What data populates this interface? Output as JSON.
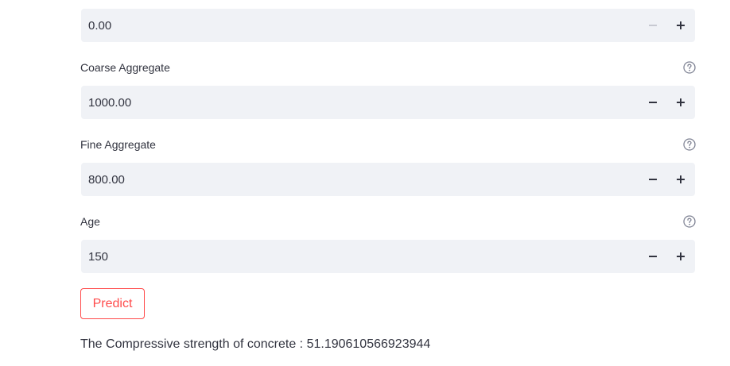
{
  "fields": [
    {
      "label": "",
      "value": "0.00",
      "decrement_disabled": true
    },
    {
      "label": "Coarse Aggregate",
      "value": "1000.00",
      "decrement_disabled": false
    },
    {
      "label": "Fine Aggregate",
      "value": "800.00",
      "decrement_disabled": false
    },
    {
      "label": "Age",
      "value": "150",
      "decrement_disabled": false
    }
  ],
  "predict_button": {
    "label": "Predict"
  },
  "result": {
    "text": "The Compressive strength of concrete : 51.190610566923944"
  },
  "colors": {
    "accent": "#ff4b4b",
    "input_bg": "#f0f2f6",
    "text": "#31333f",
    "disabled": "#c7c9d1"
  },
  "icons": {
    "help": "help-circle-icon",
    "minus": "minus-icon",
    "plus": "plus-icon"
  }
}
